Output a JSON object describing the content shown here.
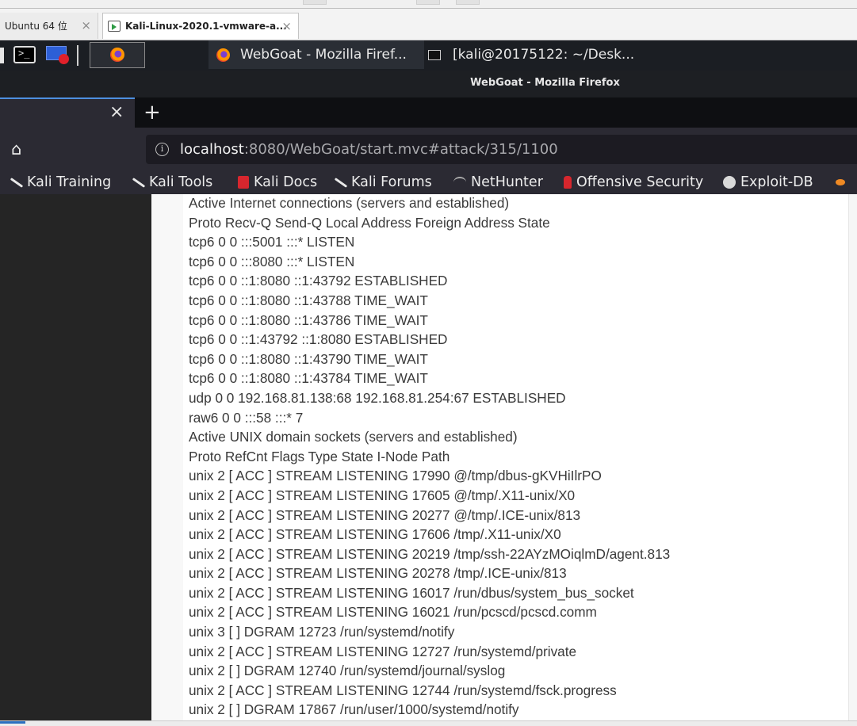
{
  "vmware": {
    "tabs": [
      {
        "label": "Ubuntu 64 位",
        "close": "×"
      },
      {
        "label": "Kali-Linux-2020.1-vmware-a...",
        "close": "×"
      }
    ]
  },
  "panel": {
    "tasks": [
      {
        "label": "WebGoat - Mozilla Firef..."
      },
      {
        "label": "[kali@20175122: ~/Desk..."
      }
    ]
  },
  "firefox": {
    "window_title": "WebGoat - Mozilla Firefox",
    "tab_close": "×",
    "new_tab": "+",
    "home_icon": "⌂",
    "url_host": "localhost",
    "url_rest": ":8080/WebGoat/start.mvc#attack/315/1100",
    "info_glyph": "i",
    "bookmarks": [
      {
        "label": "Kali Training",
        "icon": "kali-dragon-icon"
      },
      {
        "label": "Kali Tools",
        "icon": "kali-dragon-icon"
      },
      {
        "label": "Kali Docs",
        "icon": "kali-docs-icon"
      },
      {
        "label": "Kali Forums",
        "icon": "kali-dragon-icon"
      },
      {
        "label": "NetHunter",
        "icon": "nethunter-icon"
      },
      {
        "label": "Offensive Security",
        "icon": "offsec-icon"
      },
      {
        "label": "Exploit-DB",
        "icon": "exploitdb-icon"
      }
    ]
  },
  "netstat_lines": [
    "Active Internet connections (servers and established)",
    "Proto Recv-Q Send-Q Local Address Foreign Address State",
    "tcp6 0 0 :::5001 :::* LISTEN",
    "tcp6 0 0 :::8080 :::* LISTEN",
    "tcp6 0 0 ::1:8080 ::1:43792 ESTABLISHED",
    "tcp6 0 0 ::1:8080 ::1:43788 TIME_WAIT",
    "tcp6 0 0 ::1:8080 ::1:43786 TIME_WAIT",
    "tcp6 0 0 ::1:43792 ::1:8080 ESTABLISHED",
    "tcp6 0 0 ::1:8080 ::1:43790 TIME_WAIT",
    "tcp6 0 0 ::1:8080 ::1:43784 TIME_WAIT",
    "udp 0 0 192.168.81.138:68 192.168.81.254:67 ESTABLISHED",
    "raw6 0 0 :::58 :::* 7",
    "Active UNIX domain sockets (servers and established)",
    "Proto RefCnt Flags Type State I-Node Path",
    "unix 2 [ ACC ] STREAM LISTENING 17990 @/tmp/dbus-gKVHiIlrPO",
    "unix 2 [ ACC ] STREAM LISTENING 17605 @/tmp/.X11-unix/X0",
    "unix 2 [ ACC ] STREAM LISTENING 20277 @/tmp/.ICE-unix/813",
    "unix 2 [ ACC ] STREAM LISTENING 17606 /tmp/.X11-unix/X0",
    "unix 2 [ ACC ] STREAM LISTENING 20219 /tmp/ssh-22AYzMOiqlmD/agent.813",
    "unix 2 [ ACC ] STREAM LISTENING 20278 /tmp/.ICE-unix/813",
    "unix 2 [ ACC ] STREAM LISTENING 16017 /run/dbus/system_bus_socket",
    "unix 2 [ ACC ] STREAM LISTENING 16021 /run/pcscd/pcscd.comm",
    "unix 3 [ ] DGRAM 12723 /run/systemd/notify",
    "unix 2 [ ACC ] STREAM LISTENING 12727 /run/systemd/private",
    "unix 2 [ ] DGRAM 12740 /run/systemd/journal/syslog",
    "unix 2 [ ACC ] STREAM LISTENING 12744 /run/systemd/fsck.progress",
    "unix 2 [ ] DGRAM 17867 /run/user/1000/systemd/notify"
  ]
}
